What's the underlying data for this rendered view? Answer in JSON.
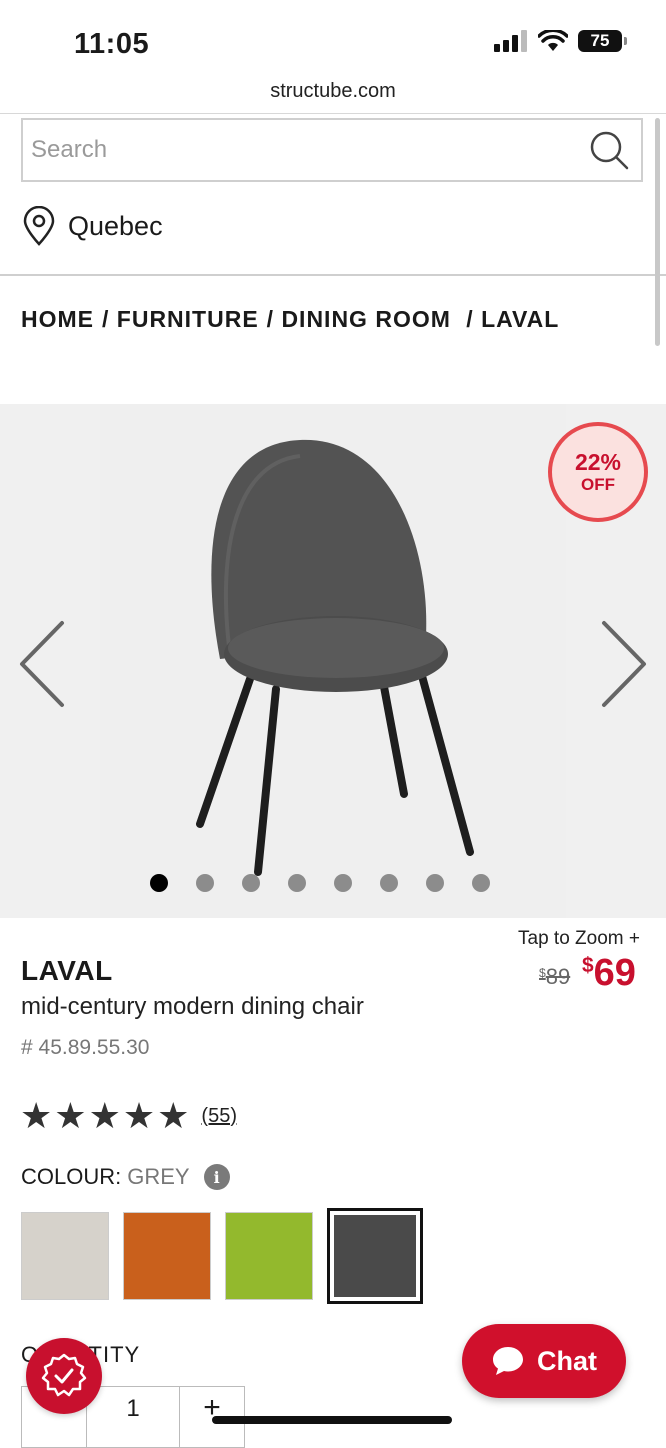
{
  "status_bar": {
    "time": "11:05",
    "battery": "75"
  },
  "browser": {
    "url": "structube.com"
  },
  "search": {
    "placeholder": "Search"
  },
  "location": {
    "label": "Quebec"
  },
  "breadcrumb": [
    "HOME",
    "/ FURNITURE",
    "/ DINING ROOM ",
    "/ LAVAL"
  ],
  "gallery": {
    "discount_pct": "22%",
    "discount_label": "OFF",
    "image_count": 8,
    "active_index": 0
  },
  "product": {
    "zoom_label": "Tap to Zoom +",
    "name": "LAVAL",
    "subtitle": "mid-century modern dining chair",
    "sku": "# 45.89.55.30",
    "old_price_symbol": "$",
    "old_price": "89",
    "new_price_symbol": "$",
    "new_price": "69",
    "rating_stars": 5,
    "reviews": "(55)",
    "colour_label": "COLOUR:",
    "colour_value": "GREY",
    "swatches": [
      {
        "name": "beige",
        "color": "#d6d2cb"
      },
      {
        "name": "orange",
        "color": "#c9601c"
      },
      {
        "name": "green",
        "color": "#93b92d"
      },
      {
        "name": "grey",
        "color": "#4a4a4a"
      }
    ],
    "quantity_label": "QUANTITY",
    "quantity_value": "1",
    "minus": "−",
    "plus": "+"
  },
  "chat": {
    "label": "Chat"
  },
  "colors": {
    "brand_red": "#c8102e",
    "badge_border": "#e64a4f"
  }
}
